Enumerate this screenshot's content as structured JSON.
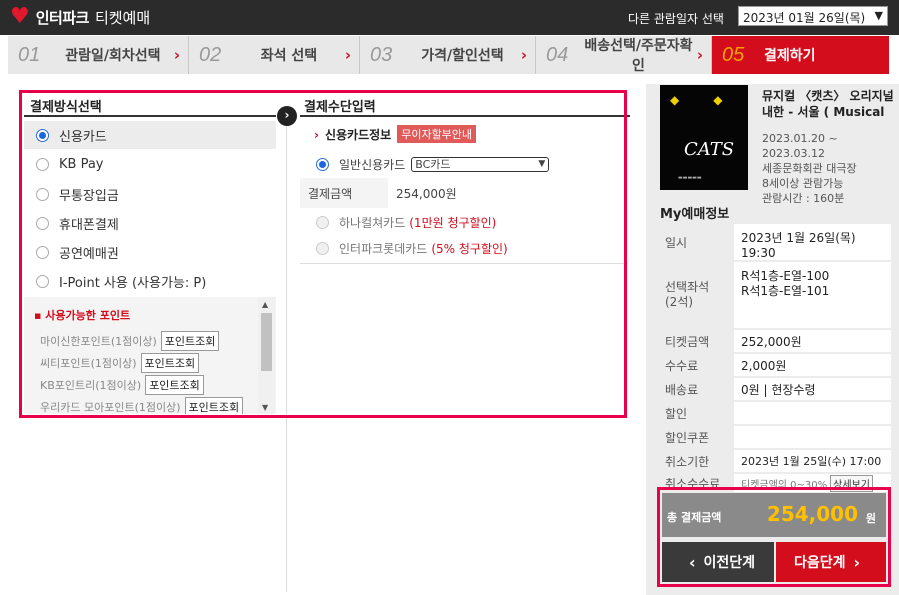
{
  "header": {
    "logo_text": "인터파크",
    "logo_sub": "티켓예매",
    "date_label": "다른 관람일자 선택",
    "date_value": "2023년 01월 26일(목)"
  },
  "steps": [
    {
      "num": "01",
      "label": "관람일/회차선택"
    },
    {
      "num": "02",
      "label": "좌석 선택"
    },
    {
      "num": "03",
      "label": "가격/할인선택"
    },
    {
      "num": "04",
      "label": "배송선택/주문자확인"
    },
    {
      "num": "05",
      "label": "결제하기"
    }
  ],
  "payment_methods": {
    "title": "결제방식선택",
    "options": [
      "신용카드",
      "KB Pay",
      "무통장입금",
      "휴대폰결제",
      "공연예매권",
      "I-Point 사용 (사용가능: P)"
    ],
    "points_title": "사용가능한 포인트",
    "points": [
      {
        "label": "마이신한포인트(1점이상)",
        "button": "포인트조회"
      },
      {
        "label": "씨티포인트(1점이상)",
        "button": "포인트조회"
      },
      {
        "label": "KB포인트리(1점이상)",
        "button": "포인트조회"
      },
      {
        "label": "우리카드 모아포인트(1점이상)",
        "button": "포인트조회"
      }
    ]
  },
  "payment_input": {
    "title": "결제수단입력",
    "card_info_label": "신용카드정보",
    "badge": "무이자할부안내",
    "general_card_label": "일반신용카드",
    "card_select": "BC카드",
    "amount_label": "결제금액",
    "amount_value": "254,000원",
    "hana_label": "하나컬쳐카드",
    "hana_discount": "(1만원 청구할인)",
    "lotte_label": "인터파크롯데카드",
    "lotte_discount": "(5% 청구할인)"
  },
  "show": {
    "poster_title": "CATS",
    "title_line1": "뮤지컬 〈캣츠〉 오리지널",
    "title_line2": "내한 - 서울 ( Musical",
    "dates": "2023.01.20 ~",
    "dates2": "2023.03.12",
    "venue": "세종문화회관 대극장",
    "age": "8세이상 관람가능",
    "runtime": "관람시간 : 160분"
  },
  "my_booking": {
    "title": "My예매정보",
    "date_label": "일시",
    "date_value": "2023년 1월 26일(목)",
    "time_value": "19:30",
    "seat_label": "선택좌석",
    "seat_count": "(2석)",
    "seat1": "R석1층-E열-100",
    "seat2": "R석1층-E열-101",
    "ticket_label": "티켓금액",
    "ticket_value": "252,000원",
    "fee_label": "수수료",
    "fee_value": "2,000원",
    "delivery_label": "배송료",
    "delivery_value": "0원 | 현장수령",
    "discount_label": "할인",
    "coupon_label": "할인쿠폰",
    "cancel_deadline_label": "취소기한",
    "cancel_deadline_value": "2023년 1월 25일(수) 17:00",
    "cancel_fee_label": "취소수수료",
    "cancel_fee_value": "티켓금액의 0~30%",
    "cancel_fee_button": "상세보기"
  },
  "total": {
    "label": "총 결제금액",
    "value": "254,000",
    "unit": "원"
  },
  "buttons": {
    "prev": "이전단계",
    "next": "다음단계"
  },
  "colors": {
    "brand_red": "#d30d1c",
    "highlight_pink": "#e8004a",
    "total_yellow": "#ffc000"
  }
}
